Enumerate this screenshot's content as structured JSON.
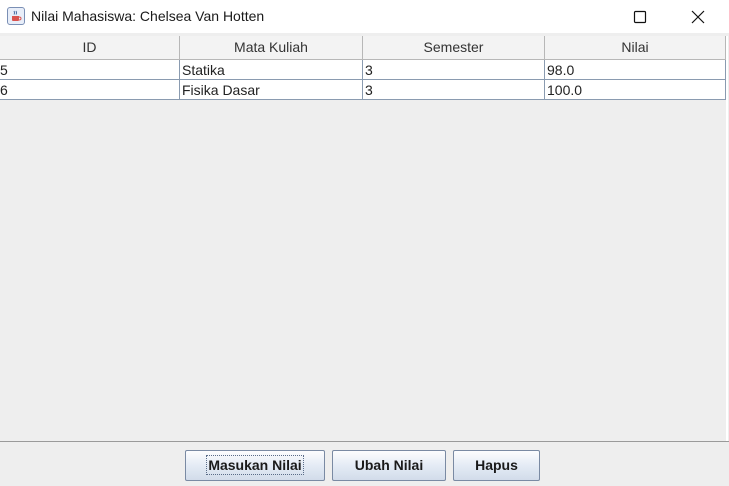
{
  "window": {
    "title": "Nilai Mahasiswa: Chelsea Van Hotten"
  },
  "table": {
    "columns": [
      "ID",
      "Mata Kuliah",
      "Semester",
      "Nilai"
    ],
    "rows": [
      [
        "5",
        "Statika",
        "3",
        "98.0"
      ],
      [
        "6",
        "Fisika Dasar",
        "3",
        "100.0"
      ]
    ]
  },
  "buttons": {
    "add": "Masukan Nilai",
    "edit": "Ubah Nilai",
    "delete": "Hapus"
  },
  "icons": {
    "app": "java-cup-icon",
    "maximize": "maximize-icon",
    "close": "close-icon"
  }
}
